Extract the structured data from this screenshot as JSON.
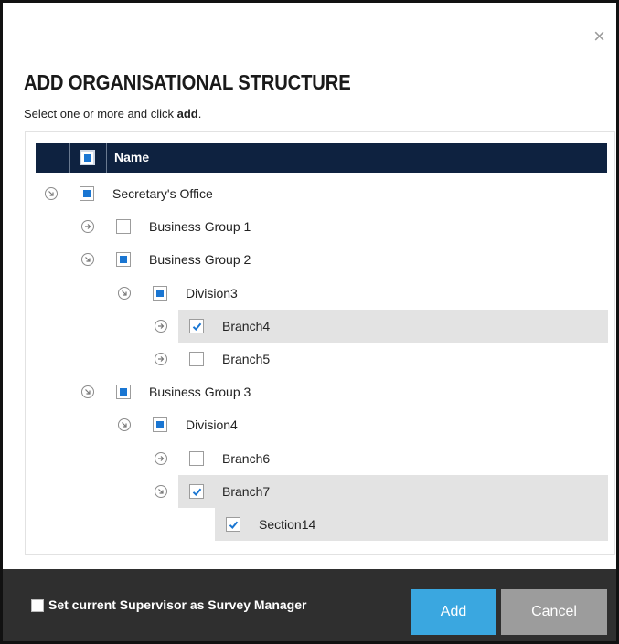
{
  "dialog": {
    "close_symbol": "×",
    "title": "ADD ORGANISATIONAL STRUCTURE",
    "subtitle_prefix": "Select one or more and click ",
    "subtitle_action": "add",
    "subtitle_suffix": "."
  },
  "tree": {
    "header": {
      "name_label": "Name",
      "select_all_state": "partial"
    },
    "rows": [
      {
        "label": "Secretary's Office",
        "level": 0,
        "expanded": true,
        "check": "partial",
        "highlight": false
      },
      {
        "label": "Business Group 1",
        "level": 1,
        "expanded": false,
        "check": "unchecked",
        "highlight": false
      },
      {
        "label": "Business Group 2",
        "level": 1,
        "expanded": true,
        "check": "partial",
        "highlight": false
      },
      {
        "label": "Division3",
        "level": 2,
        "expanded": true,
        "check": "partial",
        "highlight": false
      },
      {
        "label": "Branch4",
        "level": 3,
        "expanded": false,
        "check": "checked",
        "highlight": true
      },
      {
        "label": "Branch5",
        "level": 3,
        "expanded": false,
        "check": "unchecked",
        "highlight": false
      },
      {
        "label": "Business Group 3",
        "level": 1,
        "expanded": true,
        "check": "partial",
        "highlight": false
      },
      {
        "label": "Division4",
        "level": 2,
        "expanded": true,
        "check": "partial",
        "highlight": false
      },
      {
        "label": "Branch6",
        "level": 3,
        "expanded": false,
        "check": "unchecked",
        "highlight": false
      },
      {
        "label": "Branch7",
        "level": 3,
        "expanded": true,
        "check": "checked",
        "highlight": true
      },
      {
        "label": "Section14",
        "level": 4,
        "expanded": null,
        "check": "checked",
        "highlight": true
      }
    ]
  },
  "footer": {
    "supervisor_label": "Set current Supervisor as Survey Manager",
    "supervisor_checked": false,
    "add_label": "Add",
    "cancel_label": "Cancel"
  },
  "colors": {
    "header_bg": "#0e2240",
    "partial_fill": "#1a76d2",
    "highlight_bg": "#e3e3e3",
    "footer_bg": "#2f2f2f",
    "add_button": "#3aa7e0",
    "cancel_button": "#9c9c9c"
  },
  "icons": {
    "close": "close-icon",
    "collapsed": "arrow-right-circle-icon",
    "expanded": "arrow-down-right-circle-icon",
    "checked": "checkmark-icon"
  }
}
